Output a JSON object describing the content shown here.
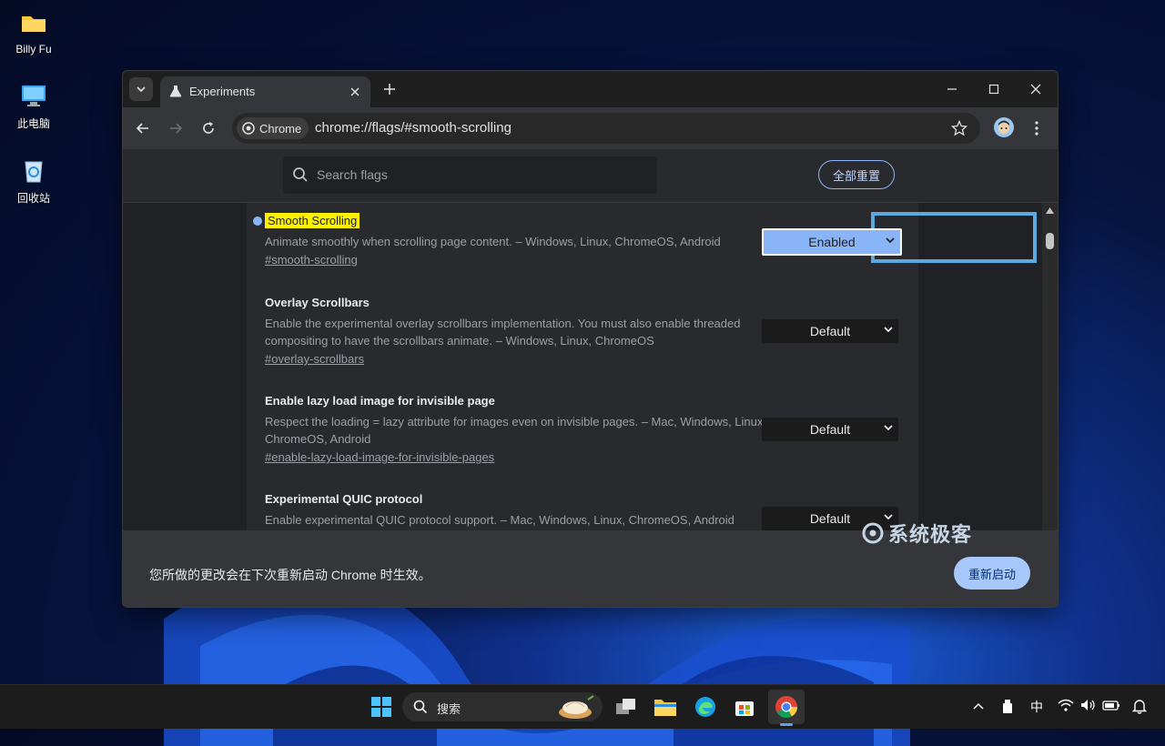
{
  "desktop": {
    "icons": [
      {
        "label": "Billy Fu",
        "icon": "folder-icon"
      },
      {
        "label": "此电脑",
        "icon": "computer-icon"
      },
      {
        "label": "回收站",
        "icon": "recycle-bin-icon"
      }
    ]
  },
  "browser": {
    "tab_title": "Experiments",
    "omnibox": {
      "chip_label": "Chrome",
      "url": "chrome://flags/#smooth-scrolling"
    },
    "search": {
      "placeholder": "Search flags"
    },
    "reset_all_label": "全部重置",
    "flags": [
      {
        "name": "Smooth Scrolling",
        "description": "Animate smoothly when scrolling page content. – Windows, Linux, ChromeOS, Android",
        "link": "#smooth-scrolling",
        "value": "Enabled",
        "highlighted": true
      },
      {
        "name": "Overlay Scrollbars",
        "description": "Enable the experimental overlay scrollbars implementation. You must also enable threaded compositing to have the scrollbars animate. – Windows, Linux, ChromeOS",
        "link": "#overlay-scrollbars",
        "value": "Default"
      },
      {
        "name": "Enable lazy load image for invisible page",
        "description": "Respect the loading = lazy attribute for images even on invisible pages. – Mac, Windows, Linux, ChromeOS, Android",
        "link": "#enable-lazy-load-image-for-invisible-pages",
        "value": "Default"
      },
      {
        "name": "Experimental QUIC protocol",
        "description": "Enable experimental QUIC protocol support. – Mac, Windows, Linux, ChromeOS, Android",
        "link": "",
        "value": "Default"
      }
    ],
    "footer": {
      "message": "您所做的更改会在下次重新启动 Chrome 时生效。",
      "relaunch_label": "重新启动"
    }
  },
  "watermark": "系统极客",
  "taskbar": {
    "search_placeholder": "搜索",
    "ime": "中"
  },
  "colors": {
    "accent": "#8ab4f8",
    "highlight": "#fff200",
    "focus_ring": "#5ca9e0"
  }
}
